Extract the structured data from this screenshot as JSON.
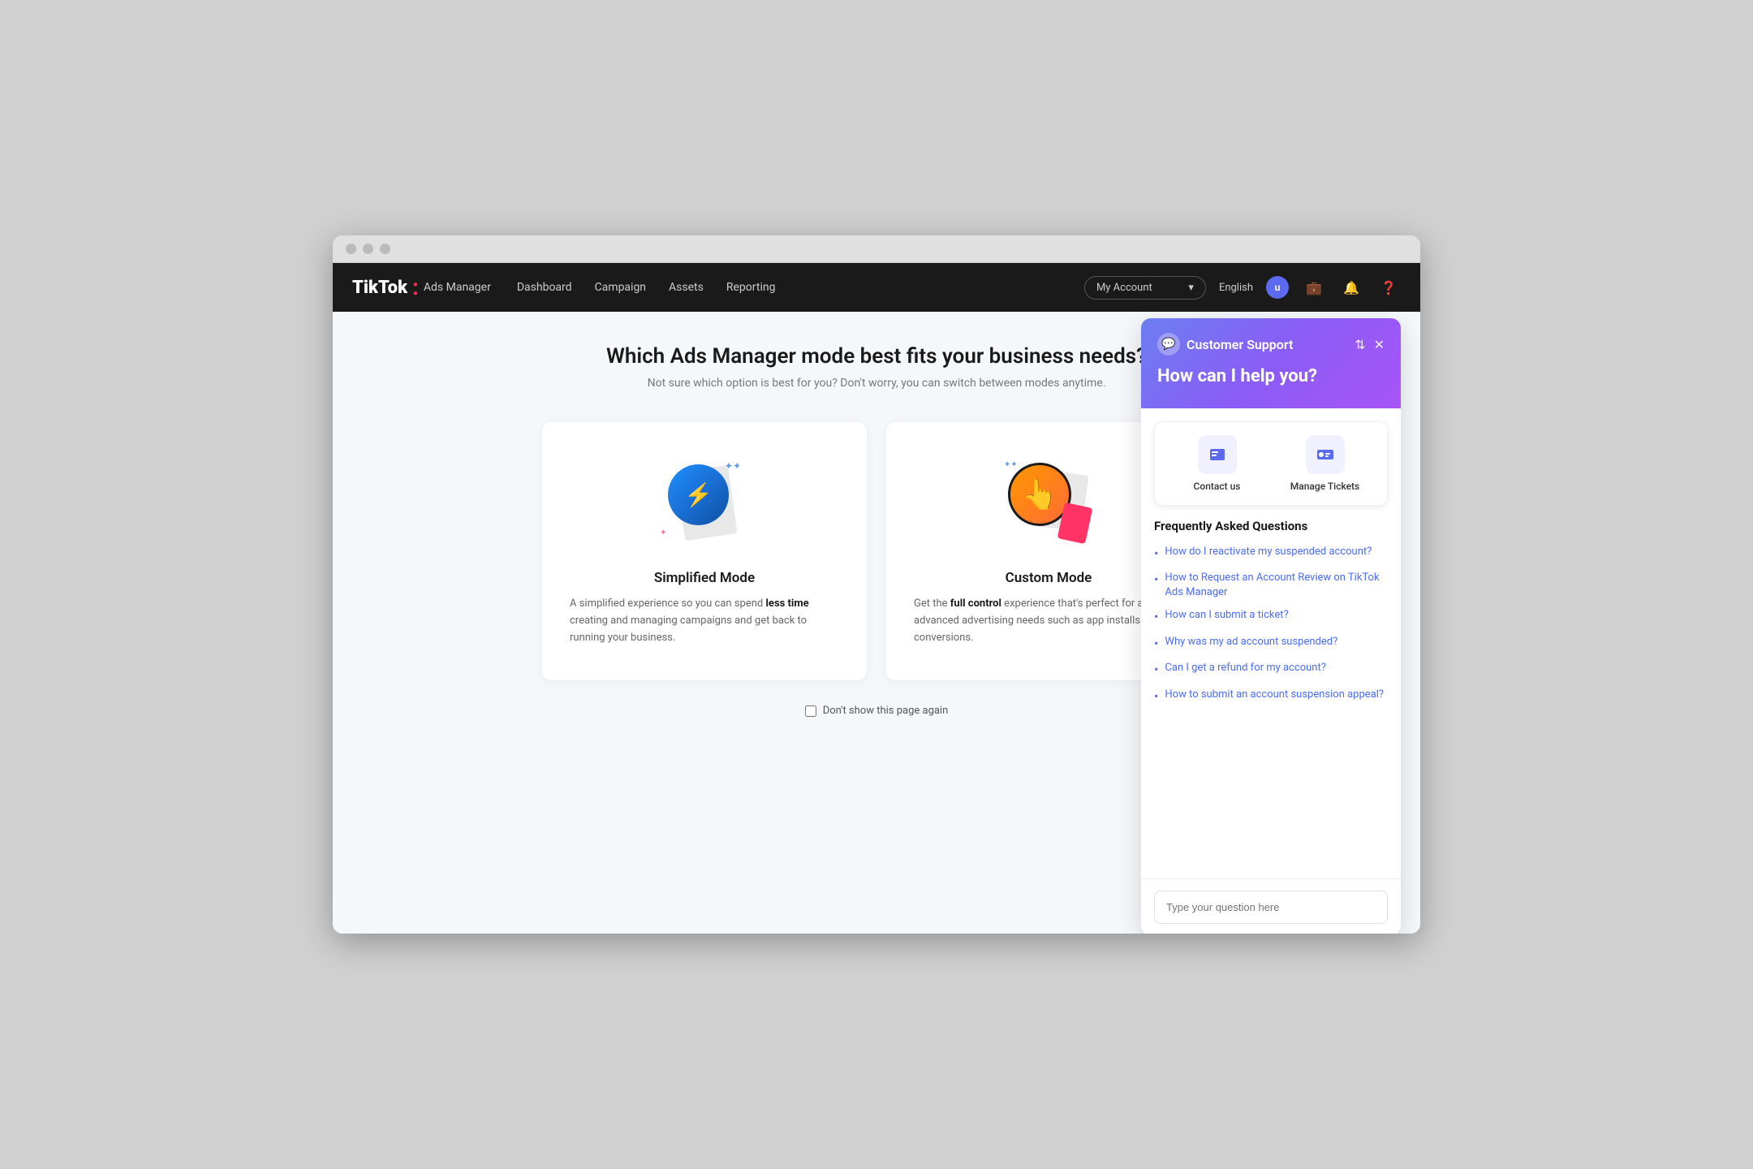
{
  "browser": {
    "title": "TikTok Ads Manager"
  },
  "topnav": {
    "logo": "TikTok",
    "logo_colon": ":",
    "ads_manager": "Ads Manager",
    "links": [
      {
        "id": "dashboard",
        "label": "Dashboard"
      },
      {
        "id": "campaign",
        "label": "Campaign"
      },
      {
        "id": "assets",
        "label": "Assets"
      },
      {
        "id": "reporting",
        "label": "Reporting"
      }
    ],
    "account_placeholder": "My Account",
    "language": "English",
    "user_initial": "u"
  },
  "main": {
    "title": "Which Ads Manager mode best fits your business needs?",
    "subtitle": "Not sure which option is best for you? Don't worry, you can switch between modes anytime.",
    "dont_show_label": "Don't show this page again"
  },
  "modes": [
    {
      "id": "simplified",
      "title": "Simplified Mode",
      "description_start": "A simplified experience so you can spend ",
      "description_bold": "less time",
      "description_end": " creating and managing campaigns and get back to running your business."
    },
    {
      "id": "custom",
      "title": "Custom Mode",
      "description_start": "Get the ",
      "description_bold": "full control",
      "description_end": " experience that's perfect for all advanced advertising needs such as app installs and conversions."
    }
  ],
  "support": {
    "title": "Customer Support",
    "question": "How can I help you?",
    "actions": [
      {
        "id": "contact-us",
        "label": "Contact us",
        "icon": "💬"
      },
      {
        "id": "manage-tickets",
        "label": "Manage Tickets",
        "icon": "🎫"
      }
    ],
    "faq_title": "Frequently Asked Questions",
    "faq_items": [
      {
        "id": "faq-1",
        "text": "How do I reactivate my suspended account?"
      },
      {
        "id": "faq-2",
        "text": "How to Request an Account Review on TikTok Ads Manager"
      },
      {
        "id": "faq-3",
        "text": "How can I submit a ticket?"
      },
      {
        "id": "faq-4",
        "text": "Why was my ad account suspended?"
      },
      {
        "id": "faq-5",
        "text": "Can I get a refund for my account?"
      },
      {
        "id": "faq-6",
        "text": "How to submit an account suspension appeal?"
      }
    ],
    "input_placeholder": "Type your question here"
  }
}
